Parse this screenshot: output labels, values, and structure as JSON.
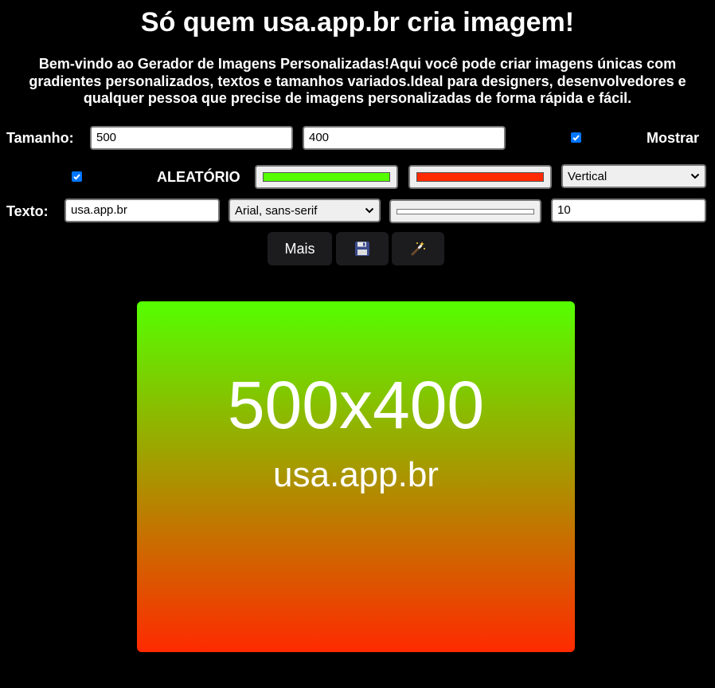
{
  "header": {
    "title": "Só quem usa.app.br cria imagem!",
    "intro": "Bem-vindo ao Gerador de Imagens Personalizadas!Aqui você pode criar imagens únicas com gradientes personalizados, textos e tamanhos variados.Ideal para designers, desenvolvedores e qualquer pessoa que precise de imagens personalizadas de forma rápida e fácil."
  },
  "size_row": {
    "label": "Tamanho:",
    "width_value": "500",
    "height_value": "400",
    "show_checked": true,
    "show_label": "Mostrar"
  },
  "gradient_row": {
    "random_checked": true,
    "random_label": "ALEATÓRIO",
    "color_start": "#55ff00",
    "color_end": "#ff2a00",
    "direction": "Vertical"
  },
  "text_row": {
    "label": "Texto:",
    "text_value": "usa.app.br",
    "font_value": "Arial, sans-serif",
    "extra_value": "10"
  },
  "buttons": {
    "more_label": "Mais",
    "save_icon": "floppy-disk-icon",
    "magic_icon": "magic-wand-icon"
  },
  "preview": {
    "size_text": "500x400",
    "watermark": "usa.app.br"
  }
}
